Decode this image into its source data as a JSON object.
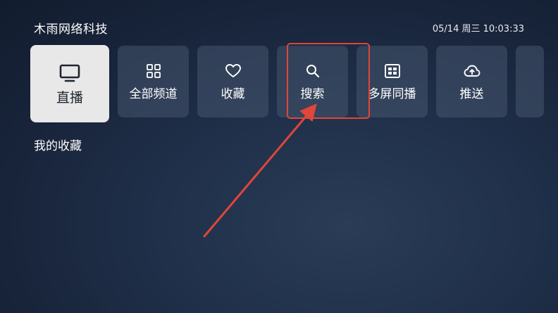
{
  "header": {
    "brand": "木雨网络科技",
    "datetime": "05/14 周三 10:03:33"
  },
  "menu": {
    "items": [
      {
        "label": "直播",
        "icon": "tv-icon"
      },
      {
        "label": "全部频道",
        "icon": "grid-icon"
      },
      {
        "label": "收藏",
        "icon": "heart-icon"
      },
      {
        "label": "搜索",
        "icon": "search-icon"
      },
      {
        "label": "多屏同播",
        "icon": "multiscreen-icon"
      },
      {
        "label": "推送",
        "icon": "cloud-upload-icon"
      }
    ],
    "active_index": 0,
    "highlighted_index": 3
  },
  "section": {
    "title": "我的收藏"
  },
  "colors": {
    "annotation": "#e0463a",
    "active_tile": "#e8e8e8",
    "tile": "#46566e"
  }
}
